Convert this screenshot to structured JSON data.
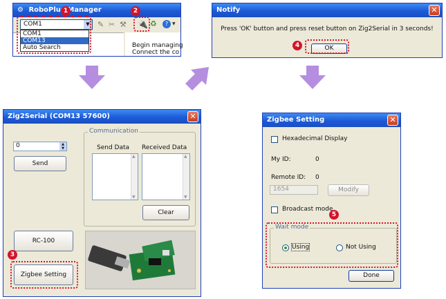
{
  "robo": {
    "title": "RoboPlus Manager",
    "combo_value": "COM1",
    "dropdown_options": [
      "COM1",
      "COM13",
      "Auto Search"
    ],
    "begin_line1": "Begin managing",
    "begin_line2": "Connect the co"
  },
  "notify": {
    "title": "Notify",
    "message": "Press 'OK' button and press reset button on Zig2Serial in 3 seconds!",
    "ok_label": "OK"
  },
  "zig2serial": {
    "title": "Zig2Serial (COM13 57600)",
    "spinner_value": "0",
    "send_label": "Send",
    "group_label": "Communication",
    "send_data_label": "Send Data",
    "received_data_label": "Received Data",
    "clear_label": "Clear",
    "rc100_label": "RC-100",
    "zigbee_setting_label": "Zigbee Setting"
  },
  "zigbee_setting": {
    "title": "Zigbee Setting",
    "hex_display_label": "Hexadecimal Display",
    "my_id_label": "My ID:",
    "my_id_value": "0",
    "remote_id_label": "Remote ID:",
    "remote_id_value": "0",
    "remote_input_value": "1654",
    "modify_label": "Modify",
    "broadcast_label": "Broadcast mode",
    "wait_mode_label": "Wait mode",
    "using_label": "Using",
    "not_using_label": "Not Using",
    "done_label": "Done"
  },
  "steps": [
    "1",
    "2",
    "3",
    "4",
    "5"
  ],
  "colors": {
    "accent_red": "#d4142a",
    "arrow_purple": "#b58ee0",
    "title_blue": "#1d5ad6"
  }
}
